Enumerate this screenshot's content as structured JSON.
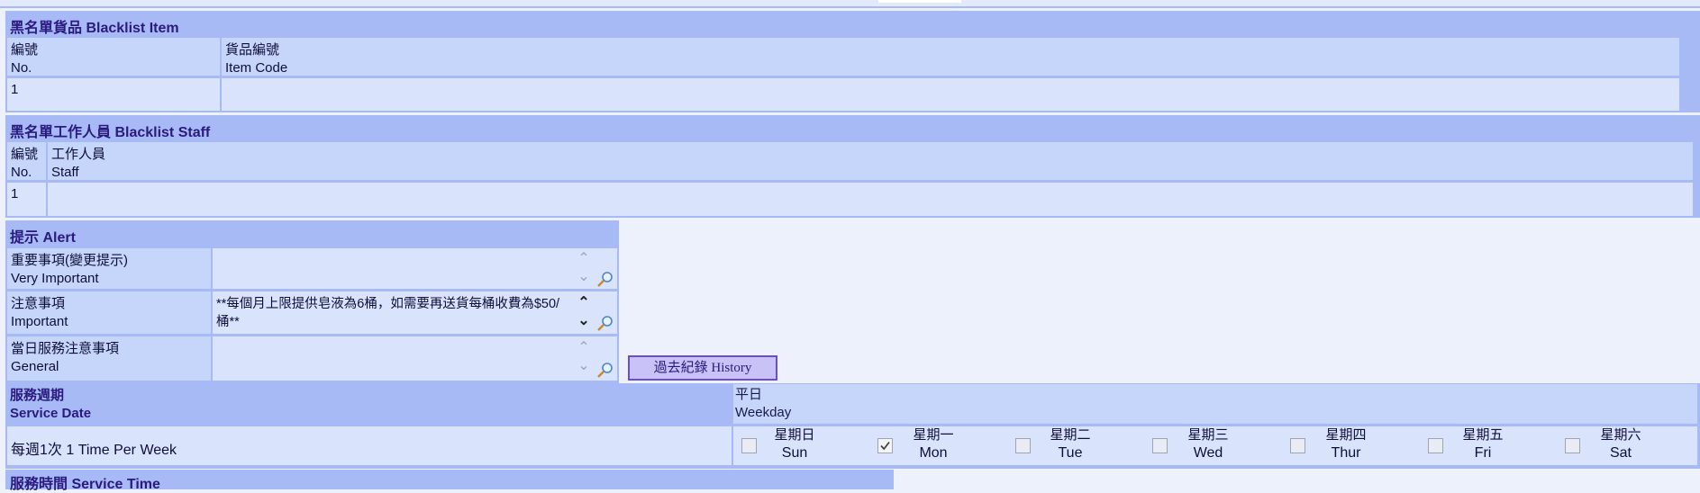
{
  "blacklist_item": {
    "title": "黑名單貨品 Blacklist Item",
    "col_no_zh": "編號",
    "col_no_en": "No.",
    "col_code_zh": "貨品編號",
    "col_code_en": "Item Code",
    "row_no": "1",
    "row_code": ""
  },
  "blacklist_staff": {
    "title": "黑名單工作人員 Blacklist Staff",
    "col_no_zh": "編號",
    "col_no_en": "No.",
    "col_staff_zh": "工作人員",
    "col_staff_en": "Staff",
    "row_no": "1",
    "row_staff": ""
  },
  "alert": {
    "title": "提示 Alert",
    "very_important_zh": "重要事項(變更提示)",
    "very_important_en": "Very Important",
    "very_important_value": "",
    "important_zh": "注意事項",
    "important_en": "Important",
    "important_value": "**每個月上限提供皂液為6桶，如需要再送貨每桶收費為$50/桶**",
    "general_zh": "當日服務注意事項",
    "general_en": "General",
    "general_value": "",
    "history_button": "過去紀錄 History"
  },
  "service_date": {
    "title_zh": "服務週期",
    "title_en": "Service Date",
    "weekday_zh": "平日",
    "weekday_en": "Weekday",
    "frequency": "每週1次 1 Time Per Week",
    "days": [
      {
        "zh": "星期日",
        "en": "Sun",
        "checked": false
      },
      {
        "zh": "星期一",
        "en": "Mon",
        "checked": true
      },
      {
        "zh": "星期二",
        "en": "Tue",
        "checked": false
      },
      {
        "zh": "星期三",
        "en": "Wed",
        "checked": false
      },
      {
        "zh": "星期四",
        "en": "Thur",
        "checked": false
      },
      {
        "zh": "星期五",
        "en": "Fri",
        "checked": false
      },
      {
        "zh": "星期六",
        "en": "Sat",
        "checked": false
      }
    ]
  },
  "service_time": {
    "title": "服務時間 Service Time"
  },
  "colors": {
    "header_bg": "#a8baf5",
    "header_text": "#2a1a7e",
    "cell_bg": "#c6d5fa",
    "data_bg": "#d9e4fc",
    "page_bg": "#edf1fc",
    "button_bg": "#c9c2f7",
    "button_border": "#6a4ecf"
  },
  "icons": [
    "scroll-up-icon",
    "scroll-down-icon",
    "magnifier-icon",
    "checkbox-icon"
  ]
}
